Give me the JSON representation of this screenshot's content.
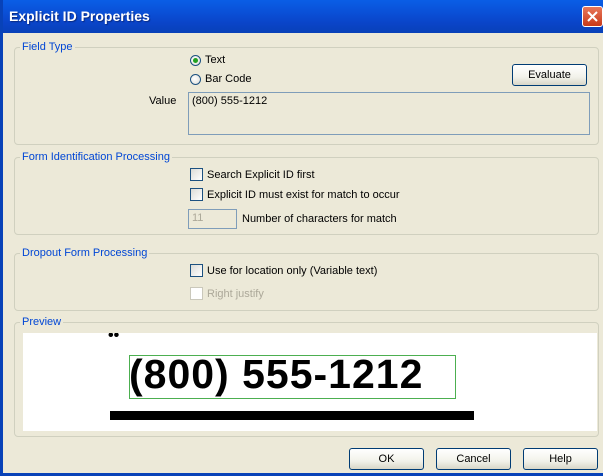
{
  "window": {
    "title": "Explicit ID Properties"
  },
  "field_type": {
    "legend": "Field Type",
    "radio_text_label": "Text",
    "radio_barcode_label": "Bar Code",
    "selected": "Text",
    "evaluate_label": "Evaluate",
    "value_label": "Value",
    "value": "(800) 555-1212"
  },
  "form_id": {
    "legend": "Form Identification Processing",
    "search_first_label": "Search Explicit ID first",
    "must_exist_label": "Explicit ID must exist for match to occur",
    "num_chars_value": "11",
    "num_chars_label": "Number of characters for match"
  },
  "dropout": {
    "legend": "Dropout Form Processing",
    "location_only_label": "Use for location only (Variable text)",
    "right_justify_label": "Right justify"
  },
  "preview": {
    "legend": "Preview",
    "text": "(800) 555-1212"
  },
  "buttons": {
    "ok": "OK",
    "cancel": "Cancel",
    "help": "Help"
  },
  "colors": {
    "titlebar": "#0a4fd6",
    "legend": "#0046d5",
    "selected_radio": "#21a121",
    "preview_box": "#4caf50"
  }
}
